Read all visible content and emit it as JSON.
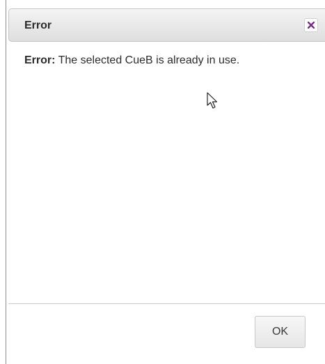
{
  "dialog": {
    "title": "Error",
    "message_label": "Error:",
    "message_text": " The selected CueB is already in use.",
    "ok_label": "OK"
  },
  "icons": {
    "close": "close-icon",
    "cursor": "mouse-pointer-icon"
  },
  "colors": {
    "close_icon": "#7b2a8a"
  }
}
